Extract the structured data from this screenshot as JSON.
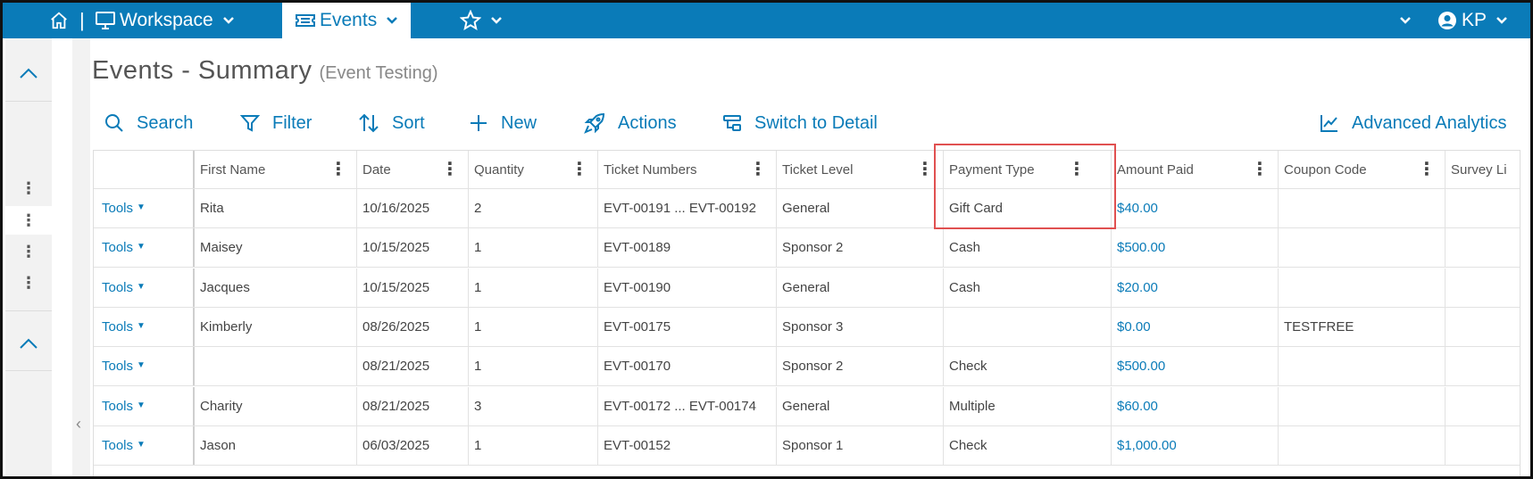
{
  "topbar": {
    "workspace_label": "Workspace",
    "events_label": "Events",
    "separator": "|",
    "user_initials": "KP"
  },
  "page": {
    "title": "Events - Summary",
    "subtitle": "(Event Testing)"
  },
  "toolbar": {
    "search": "Search",
    "filter": "Filter",
    "sort": "Sort",
    "new": "New",
    "actions": "Actions",
    "switch": "Switch to Detail",
    "analytics": "Advanced Analytics"
  },
  "grid": {
    "tools_label": "Tools",
    "columns": [
      "First Name",
      "Date",
      "Quantity",
      "Ticket Numbers",
      "Ticket Level",
      "Payment Type",
      "Amount Paid",
      "Coupon Code",
      "Survey Li"
    ],
    "rows": [
      [
        "Rita",
        "10/16/2025",
        "2",
        "EVT-00191 ... EVT-00192",
        "General",
        "Gift Card",
        "$40.00",
        "",
        ""
      ],
      [
        "Maisey",
        "10/15/2025",
        "1",
        "EVT-00189",
        "Sponsor 2",
        "Cash",
        "$500.00",
        "",
        ""
      ],
      [
        "Jacques",
        "10/15/2025",
        "1",
        "EVT-00190",
        "General",
        "Cash",
        "$20.00",
        "",
        ""
      ],
      [
        "Kimberly",
        "08/26/2025",
        "1",
        "EVT-00175",
        "Sponsor 3",
        "",
        "$0.00",
        "TESTFREE",
        ""
      ],
      [
        "",
        "08/21/2025",
        "1",
        "EVT-00170",
        "Sponsor 2",
        "Check",
        "$500.00",
        "",
        ""
      ],
      [
        "Charity",
        "08/21/2025",
        "3",
        "EVT-00172 ... EVT-00174",
        "General",
        "Multiple",
        "$60.00",
        "",
        ""
      ],
      [
        "Jason",
        "06/03/2025",
        "1",
        "EVT-00152",
        "Sponsor 1",
        "Check",
        "$1,000.00",
        "",
        ""
      ]
    ]
  },
  "colors": {
    "brand": "#0a7bb8",
    "highlight": "#e05050"
  }
}
